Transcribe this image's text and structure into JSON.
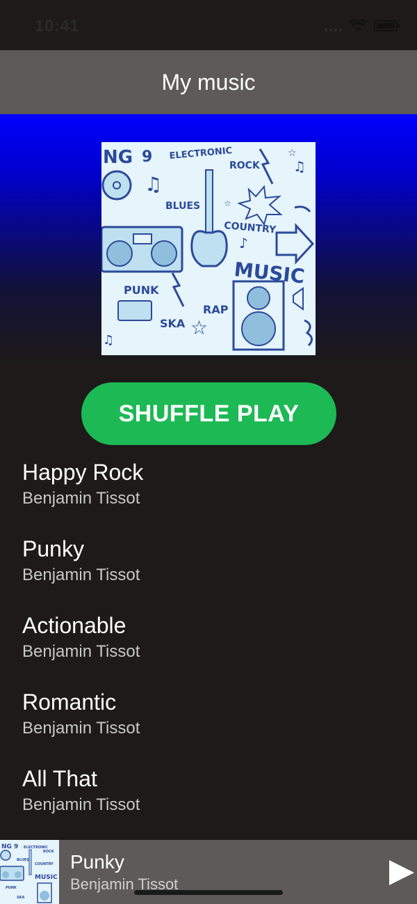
{
  "status": {
    "time": "10:41"
  },
  "header": {
    "title": "My music"
  },
  "album": {
    "art_labels": [
      "NG",
      "ELECTRONIC",
      "ROCK",
      "BLUES",
      "COUNTRY",
      "MUSIC",
      "PUNK",
      "RAP",
      "SKA"
    ]
  },
  "shuffle": {
    "label": "SHUFFLE PLAY"
  },
  "tracks": [
    {
      "title": "Happy Rock",
      "artist": "Benjamin Tissot"
    },
    {
      "title": "Punky",
      "artist": "Benjamin Tissot"
    },
    {
      "title": "Actionable",
      "artist": "Benjamin Tissot"
    },
    {
      "title": "Romantic",
      "artist": "Benjamin Tissot"
    },
    {
      "title": "All That",
      "artist": "Benjamin Tissot"
    }
  ],
  "now_playing": {
    "title": "Punky",
    "artist": "Benjamin Tissot"
  },
  "colors": {
    "accent": "#1db954",
    "header_bg": "#5d5a59",
    "background": "#1d1a19",
    "gradient_top": "#0000ff"
  },
  "icons": {
    "play": "play-icon",
    "wifi": "wifi-icon",
    "battery": "battery-icon",
    "signal": "signal-icon"
  }
}
